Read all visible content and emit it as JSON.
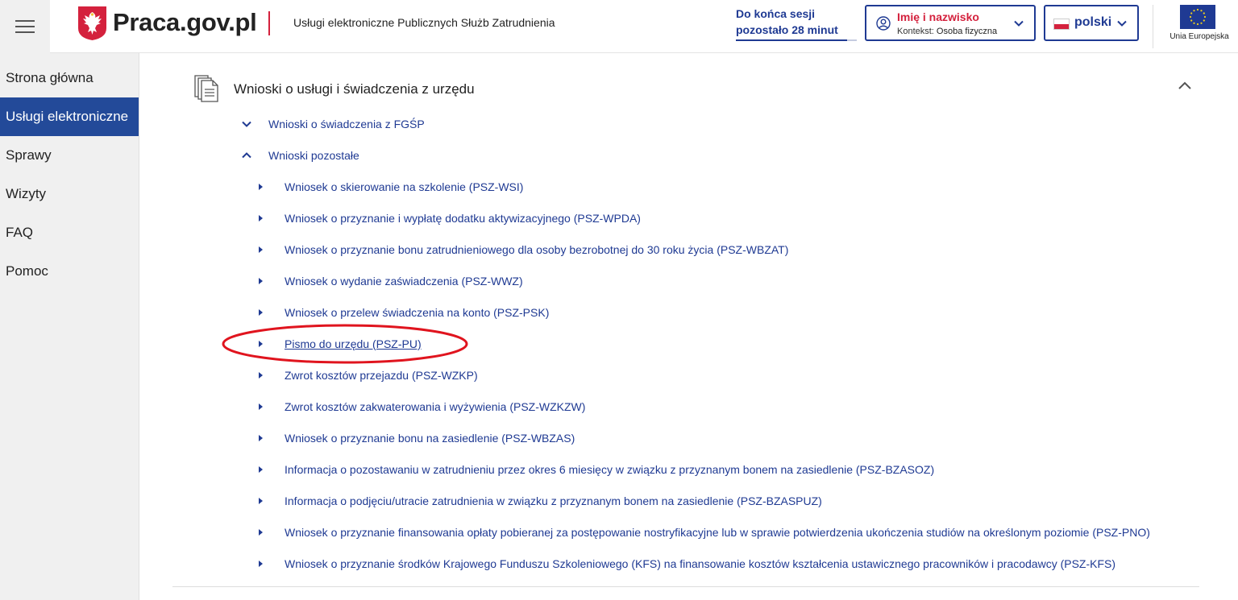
{
  "header": {
    "site_name": "Praca.gov.pl",
    "tagline": "Usługi elektroniczne Publicznych Służb Zatrudnienia",
    "session_line1": "Do końca sesji",
    "session_line2": "pozostało 28 minut",
    "user": {
      "name": "Imię i nazwisko",
      "context_label": "Kontekst:",
      "context_value": "Osoba fizyczna"
    },
    "language": "polski",
    "eu_label": "Unia Europejska"
  },
  "sidebar": {
    "items": [
      {
        "label": "Strona główna",
        "active": false
      },
      {
        "label": "Usługi elektroniczne",
        "active": true
      },
      {
        "label": "Sprawy",
        "active": false
      },
      {
        "label": "Wizyty",
        "active": false
      },
      {
        "label": "FAQ",
        "active": false
      },
      {
        "label": "Pomoc",
        "active": false
      }
    ]
  },
  "main": {
    "section_title": "Wnioski o usługi i świadczenia z urzędu",
    "groups": [
      {
        "label": "Wnioski o świadczenia z FGŚP",
        "expanded": false
      },
      {
        "label": "Wnioski pozostałe",
        "expanded": true
      }
    ],
    "items": [
      "Wniosek o skierowanie na szkolenie (PSZ-WSI)",
      "Wniosek o przyznanie i wypłatę dodatku aktywizacyjnego (PSZ-WPDA)",
      "Wniosek o przyznanie bonu zatrudnieniowego dla osoby bezrobotnej do 30 roku życia (PSZ-WBZAT)",
      "Wniosek o wydanie zaświadczenia (PSZ-WWZ)",
      "Wniosek o przelew świadczenia na konto (PSZ-PSK)",
      "Pismo do urzędu (PSZ-PU)",
      "Zwrot kosztów przejazdu (PSZ-WZKP)",
      "Zwrot kosztów zakwaterowania i wyżywienia (PSZ-WZKZW)",
      "Wniosek o przyznanie bonu na zasiedlenie (PSZ-WBZAS)",
      "Informacja o pozostawaniu w zatrudnieniu przez okres 6 miesięcy w związku z przyznanym bonem na zasiedlenie (PSZ-BZASOZ)",
      "Informacja o podjęciu/utracie zatrudnienia w związku z przyznanym bonem na zasiedlenie (PSZ-BZASPUZ)",
      "Wniosek o przyznanie finansowania opłaty pobieranej za postępowanie nostryfikacyjne lub w sprawie potwierdzenia ukończenia studiów na określonym poziomie (PSZ-PNO)",
      "Wniosek o przyznanie środków Krajowego Funduszu Szkoleniowego (KFS) na finansowanie kosztów kształcenia ustawicznego pracowników i pracodawcy (PSZ-KFS)"
    ],
    "highlighted_item": "Pismo do urzędu (PSZ-PU)"
  },
  "colors": {
    "primary": "#1f3a93",
    "accent_red": "#d4213d",
    "sidebar_bg": "#f0f0f0",
    "sidebar_active": "#234a99",
    "annotation": "#e0141e"
  }
}
